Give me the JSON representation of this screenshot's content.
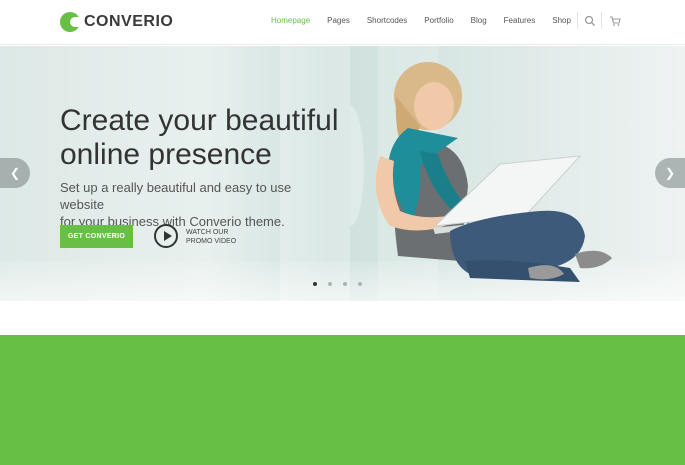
{
  "brand": {
    "name": "CONVERIO",
    "accent": "#68bf46"
  },
  "nav": {
    "items": [
      {
        "label": "Homepage",
        "active": true
      },
      {
        "label": "Pages",
        "active": false
      },
      {
        "label": "Shortcodes",
        "active": false
      },
      {
        "label": "Portfolio",
        "active": false
      },
      {
        "label": "Blog",
        "active": false
      },
      {
        "label": "Features",
        "active": false
      },
      {
        "label": "Shop",
        "active": false
      }
    ],
    "icons": [
      "search-icon",
      "cart-icon"
    ]
  },
  "hero": {
    "title_line1": "Create your beautiful",
    "title_line2": "online presence",
    "subtitle_line1": "Set up a really beautiful and easy to use website",
    "subtitle_line2": "for your business with Converio theme.",
    "cta_label": "GET CONVERIO",
    "video_line1": "WATCH OUR",
    "video_line2": "PROMO VIDEO",
    "slide_count": 4,
    "active_slide": 1
  }
}
